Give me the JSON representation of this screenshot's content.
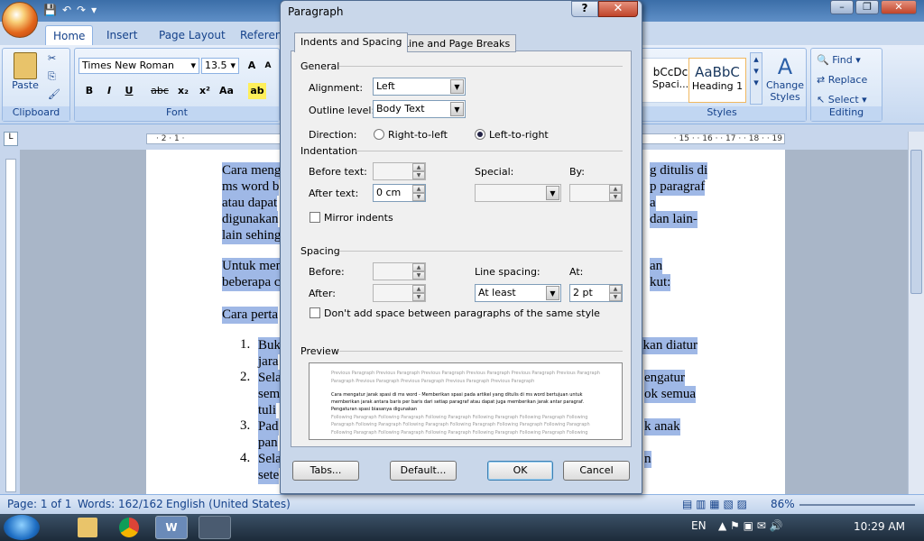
{
  "ribbon": {
    "tabs": [
      "Home",
      "Insert",
      "Page Layout",
      "Referen"
    ],
    "paste_label": "Paste",
    "font_name": "Times New Roman",
    "font_size": "13.5",
    "bold": "B",
    "italic": "I",
    "underline": "U",
    "strike": "abc",
    "sub": "x₂",
    "sup": "x²",
    "case": "Aa",
    "groups": {
      "clipboard": "Clipboard",
      "font": "Font",
      "styles": "Styles",
      "editing": "Editing"
    },
    "style_items": [
      {
        "sample": "bCcDc",
        "name": "Spaci..."
      },
      {
        "sample": "AaBbC",
        "name": "Heading 1"
      }
    ],
    "change_styles": "Change Styles",
    "find": "Find",
    "replace": "Replace",
    "select": "Select"
  },
  "ruler": {
    "marks_left": "· 2 · 1 ·",
    "marks_right": "· 15 · · 16 · · 17 · · 18 · · 19"
  },
  "document": {
    "lines_left": [
      "Cara menga",
      "ms word b",
      "atau dapat",
      "digunakan",
      "lain sehing",
      "",
      "Untuk men",
      "beberapa c",
      "",
      "Cara perta"
    ],
    "lines_right": [
      "g ditulis di",
      "p paragraf",
      "a",
      "dan lain-",
      "",
      "",
      "an",
      "kut:",
      "",
      ""
    ],
    "list_items": [
      {
        "num": "1.",
        "left": "Buk",
        "left2": "jara",
        "right": "akan diatur"
      },
      {
        "num": "2.",
        "left": "Sela",
        "left2": "sem",
        "left3": "tuli",
        "right": "engatur",
        "right2": "ok semua"
      },
      {
        "num": "3.",
        "left": "Pad",
        "left2": "pan",
        "right": "k anak"
      },
      {
        "num": "4.",
        "left": "Sela",
        "left2": "sete",
        "right": "n"
      }
    ]
  },
  "dialog": {
    "title": "Paragraph",
    "help": "?",
    "close": "✕",
    "tabs": {
      "indents": "Indents and Spacing",
      "breaks": "Line and Page Breaks"
    },
    "general": {
      "heading": "General",
      "alignment_label": "Alignment:",
      "alignment_value": "Left",
      "outline_label": "Outline level:",
      "outline_value": "Body Text",
      "direction_label": "Direction:",
      "rtl": "Right-to-left",
      "ltr": "Left-to-right"
    },
    "indentation": {
      "heading": "Indentation",
      "before_label": "Before text:",
      "before_value": "",
      "after_label": "After text:",
      "after_value": "0 cm",
      "special_label": "Special:",
      "special_value": "",
      "by_label": "By:",
      "by_value": "",
      "mirror": "Mirror indents"
    },
    "spacing": {
      "heading": "Spacing",
      "before_label": "Before:",
      "before_value": "",
      "after_label": "After:",
      "after_value": "",
      "line_label": "Line spacing:",
      "line_value": "At least",
      "at_label": "At:",
      "at_value": "2 pt",
      "dont_add": "Don't add space between paragraphs of the same style"
    },
    "preview": {
      "heading": "Preview",
      "prev": [
        "Previous Paragraph Previous Paragraph Previous Paragraph Previous Paragraph Previous Paragraph Previous Paragraph",
        "Paragraph Previous Paragraph Previous Paragraph Previous Paragraph Previous Paragraph"
      ],
      "current": [
        "Cara mengatur jarak spasi di ms word - Memberikan spasi pada artikel yang ditulis di ms word bertujuan untuk",
        "memberikan jarak antara baris per baris dari setiap paragraf atau dapat juga memberikan jarak antar paragraf.",
        "Pengaturan spasi biasanya digunakan"
      ],
      "following": [
        "Following Paragraph Following Paragraph Following Paragraph Following Paragraph Following Paragraph Following",
        "Paragraph Following Paragraph Following Paragraph Following Paragraph Following Paragraph Following Paragraph",
        "Following Paragraph Following Paragraph Following Paragraph Following Paragraph Following Paragraph Following"
      ]
    },
    "buttons": {
      "tabs": "Tabs...",
      "default": "Default...",
      "ok": "OK",
      "cancel": "Cancel"
    }
  },
  "status": {
    "page": "Page: 1 of 1",
    "words": "Words: 162/162",
    "language": "English (United States)",
    "zoom": "86%"
  },
  "taskbar": {
    "lang": "EN",
    "time": "10:29 AM"
  }
}
